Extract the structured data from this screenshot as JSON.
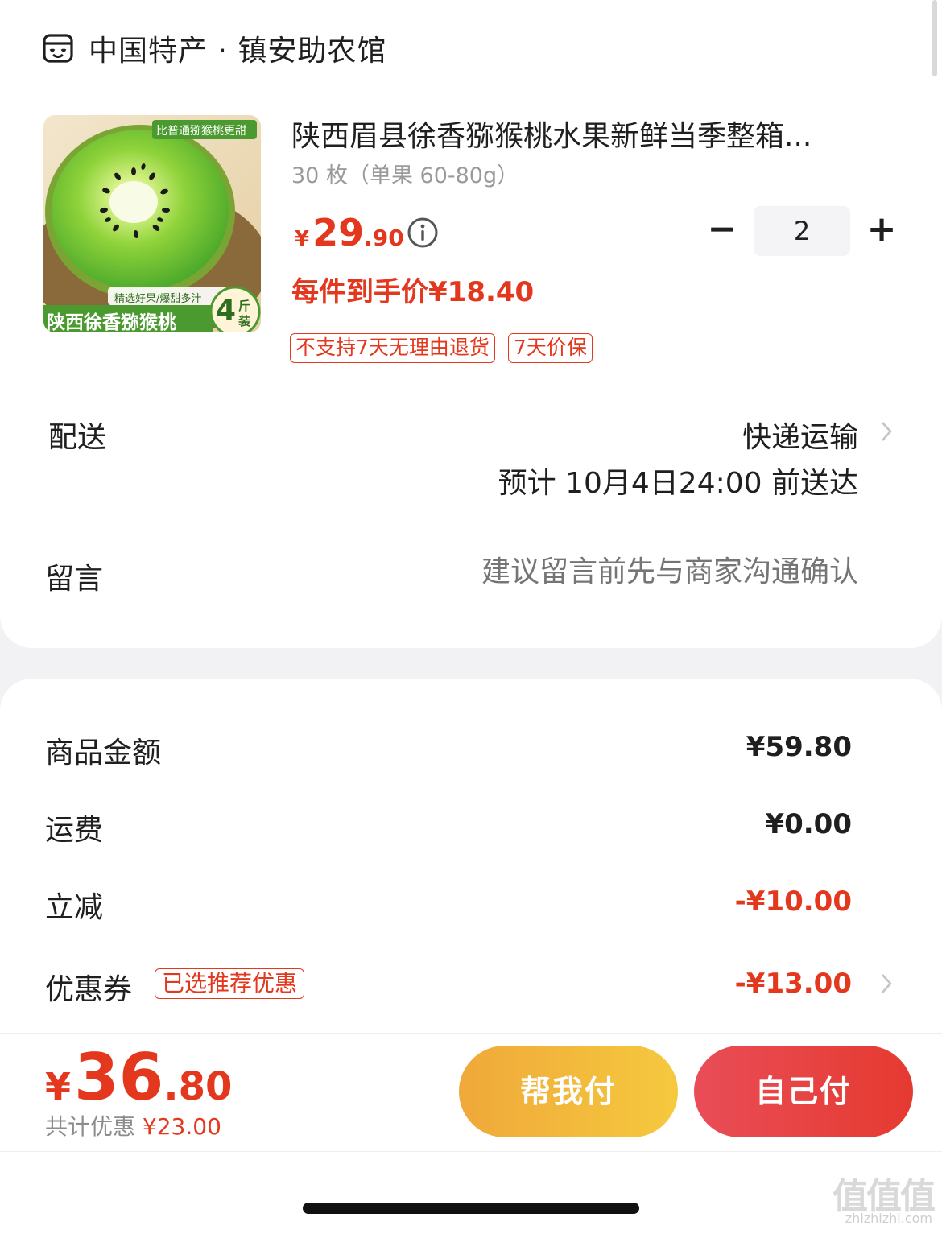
{
  "shop": {
    "name": "中国特产 · 镇安助农馆",
    "icon": "shop-icon"
  },
  "product": {
    "image_badge_top": "比普通猕猴桃更甜",
    "image_badge_mid": "精选好果/爆甜多汁",
    "image_caption": "陕西徐香猕猴桃",
    "image_weight_num": "4",
    "image_weight_unit_1": "斤",
    "image_weight_unit_2": "装",
    "title": "陕西眉县徐香猕猴桃水果新鲜当季整箱...",
    "spec": "30 枚（单果 60-80g）",
    "price_symbol": "¥",
    "price_int": "29",
    "price_dec": ".90",
    "unit_price": "每件到手价¥18.40",
    "tags": [
      "不支持7天无理由退货",
      "7天价保"
    ],
    "quantity": "2",
    "minus_label": "−",
    "plus_label": "+"
  },
  "delivery": {
    "label": "配送",
    "method": "快递运输",
    "eta": "预计 10月4日24:00 前送达"
  },
  "message": {
    "label": "留言",
    "placeholder": "建议留言前先与商家沟通确认"
  },
  "summary": {
    "goods_label": "商品金额",
    "goods_value": "¥59.80",
    "shipping_label": "运费",
    "shipping_value": "¥0.00",
    "discount_label": "立减",
    "discount_value": "-¥10.00",
    "coupon_label": "优惠券",
    "coupon_badge": "已选推荐优惠",
    "coupon_value": "-¥13.00"
  },
  "footer": {
    "total_symbol": "¥",
    "total_int": "36",
    "total_dec": ".80",
    "saving_label": "共计优惠",
    "saving_value": "¥23.00",
    "help_pay": "帮我付",
    "self_pay": "自己付",
    "watermark": "值值值",
    "watermark_url": "zhizhizhi.com"
  },
  "colors": {
    "accent_red": "#e3371e",
    "help_button": "#f2b63c",
    "self_button": "#e6423a"
  }
}
